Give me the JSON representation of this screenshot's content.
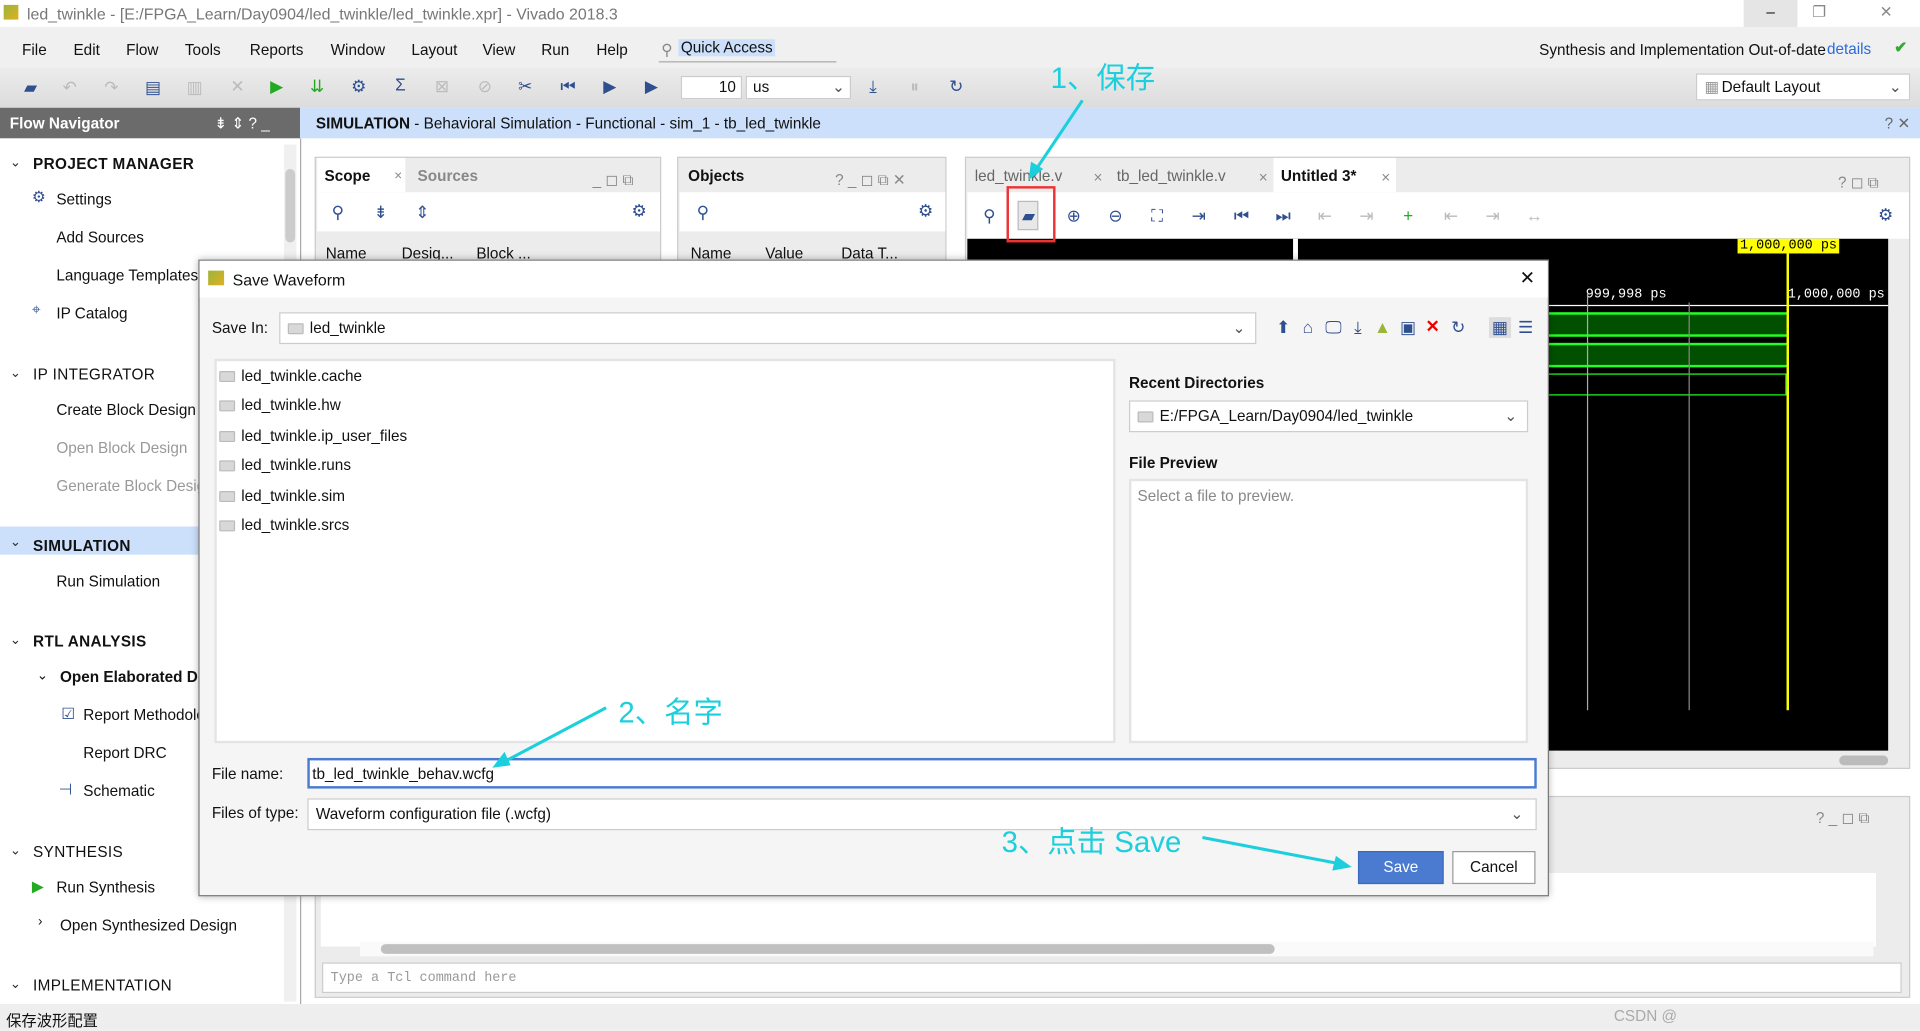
{
  "window": {
    "title": "led_twinkle - [E:/FPGA_Learn/Day0904/led_twinkle/led_twinkle.xpr] - Vivado 2018.3"
  },
  "menu": [
    "File",
    "Edit",
    "Flow",
    "Tools",
    "Reports",
    "Window",
    "Layout",
    "View",
    "Run",
    "Help"
  ],
  "quick_access": "Quick Access",
  "status_right": {
    "text": "Synthesis and Implementation Out-of-date",
    "link": "details"
  },
  "toolbar": {
    "run_time": "10",
    "run_unit": "us",
    "layout": "Default Layout"
  },
  "flow_navigator": {
    "title": "Flow Navigator",
    "sections": [
      {
        "label": "PROJECT MANAGER",
        "items": [
          "Settings",
          "Add Sources",
          "Language Templates",
          "IP Catalog"
        ]
      },
      {
        "label": "IP INTEGRATOR",
        "items": [
          "Create Block Design",
          "Open Block Design",
          "Generate Block Design"
        ]
      },
      {
        "label": "SIMULATION",
        "items": [
          "Run Simulation"
        ]
      },
      {
        "label": "RTL ANALYSIS",
        "items": [
          "Open Elaborated Design",
          "Report Methodology",
          "Report DRC",
          "Schematic"
        ]
      },
      {
        "label": "SYNTHESIS",
        "items": [
          "Run Synthesis",
          "Open Synthesized Design"
        ]
      },
      {
        "label": "IMPLEMENTATION",
        "items": []
      }
    ]
  },
  "sim_header": {
    "bold": "SIMULATION",
    "rest": " - Behavioral Simulation - Functional - sim_1 - tb_led_twinkle"
  },
  "scope_panel": {
    "tabs": [
      "Scope",
      "Sources"
    ],
    "columns": [
      "Name",
      "Desig...",
      "Block ..."
    ]
  },
  "objects_panel": {
    "title": "Objects",
    "columns": [
      "Name",
      "Value",
      "Data T..."
    ]
  },
  "wave": {
    "tabs": [
      "led_twinkle.v",
      "tb_led_twinkle.v",
      "Untitled 3*"
    ],
    "cursor": "1,000,000 ps",
    "ticks": [
      "999,998 ps",
      "1,000,000 ps"
    ]
  },
  "console": {
    "placeholder": "Type a Tcl command here"
  },
  "dialog": {
    "title": "Save Waveform",
    "save_in_label": "Save In:",
    "save_in": "led_twinkle",
    "files": [
      "led_twinkle.cache",
      "led_twinkle.hw",
      "led_twinkle.ip_user_files",
      "led_twinkle.runs",
      "led_twinkle.sim",
      "led_twinkle.srcs"
    ],
    "recent_label": "Recent Directories",
    "recent": "E:/FPGA_Learn/Day0904/led_twinkle",
    "preview_label": "File Preview",
    "preview_text": "Select a file to preview.",
    "filename_label": "File name:",
    "filename": "tb_led_twinkle_behav.wcfg",
    "filetype_label": "Files of type:",
    "filetype": "Waveform configuration file (.wcfg)",
    "save": "Save",
    "cancel": "Cancel"
  },
  "annotations": [
    "1、保存",
    "2、名字",
    "3、点击 Save"
  ],
  "statusbar": "保存波形配置",
  "watermark": "CSDN @",
  "colors": {
    "accent": "#4a7bd0",
    "annotation": "#1ccfdc",
    "highlight": "#cce0fc",
    "wave_bus": "#005000",
    "cursor": "#ffff00"
  }
}
